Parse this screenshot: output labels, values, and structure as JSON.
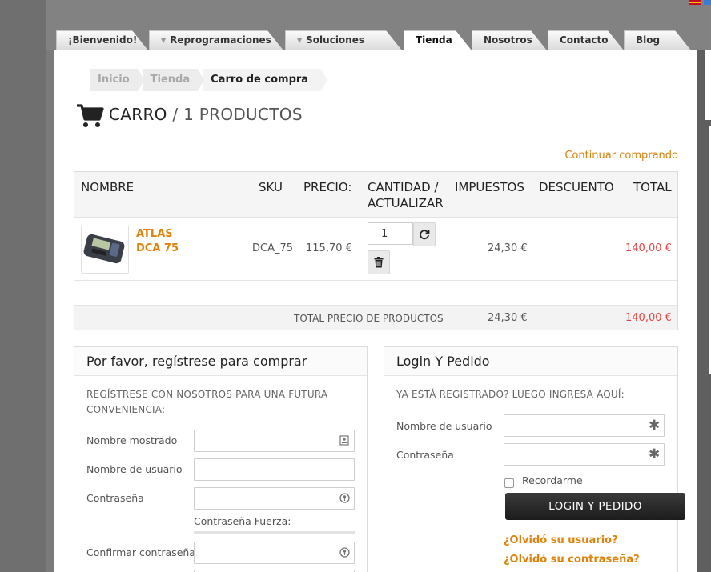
{
  "nav": {
    "tabs": [
      {
        "label": "¡Bienvenido!",
        "dropdown": false
      },
      {
        "label": "Reprogramaciones",
        "dropdown": true
      },
      {
        "label": "Soluciones",
        "dropdown": true
      },
      {
        "label": "Tienda",
        "dropdown": false,
        "active": true
      },
      {
        "label": "Nosotros",
        "dropdown": false
      },
      {
        "label": "Contacto",
        "dropdown": false
      },
      {
        "label": "Blog",
        "dropdown": false
      }
    ]
  },
  "breadcrumb": [
    "Inicio",
    "Tienda",
    "Carro de compra"
  ],
  "header": {
    "title": "CARRO",
    "separator": "/",
    "count_label": "1 PRODUCTOS",
    "continue_link": "Continuar comprando"
  },
  "cart": {
    "columns": {
      "name": "NOMBRE",
      "sku": "SKU",
      "price": "PRECIO:",
      "qty_line1": "CANTIDAD /",
      "qty_line2": "ACTUALIZAR",
      "tax": "IMPUESTOS",
      "discount": "DESCUENTO",
      "total": "TOTAL"
    },
    "item": {
      "name_line1": "ATLAS",
      "name_line2": "DCA 75",
      "sku": "DCA_75",
      "price": "115,70 €",
      "quantity": "1",
      "tax": "24,30 €",
      "total": "140,00 €"
    },
    "totals": {
      "label": "TOTAL PRECIO DE PRODUCTOS",
      "tax": "24,30 €",
      "total": "140,00 €"
    }
  },
  "register": {
    "title": "Por favor, regístrese para comprar",
    "intro_line1": "REGÍSTRESE CON NOSOTROS PARA UNA FUTURA",
    "intro_line2": "CONVENIENCIA:",
    "display_name_label": "Nombre mostrado",
    "username_label": "Nombre de usuario",
    "password_label": "Contraseña",
    "strength_label": "Contraseña Fuerza:",
    "confirm_label": "Confirmar contraseña"
  },
  "login": {
    "title": "Login Y Pedido",
    "intro": "YA ESTÁ REGISTRADO? LUEGO INGRESA AQUÍ:",
    "username_label": "Nombre de usuario",
    "password_label": "Contraseña",
    "remember_label": "Recordarme",
    "button_label": "LOGIN Y PEDIDO",
    "forgot_user": "¿Olvidó su usuario?",
    "forgot_password": "¿Olvidó su contraseña?"
  }
}
